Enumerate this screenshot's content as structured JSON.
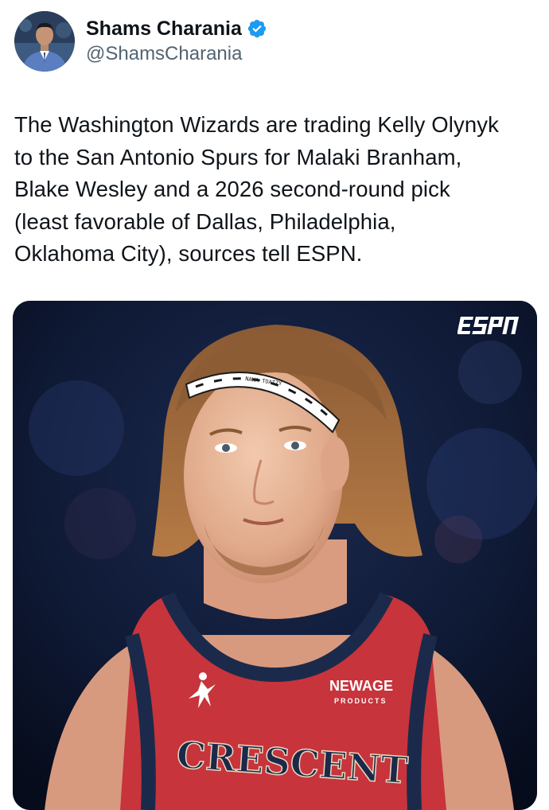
{
  "author": {
    "display_name": "Shams Charania",
    "handle": "@ShamsCharania",
    "verified": true,
    "avatar_icon": "profile-photo-icon",
    "verified_icon": "verified-badge-icon"
  },
  "tweet": {
    "text_lines": [
      "The Washington Wizards are trading Kelly Olynyk",
      "to the San Antonio Spurs for Malaki Branham,",
      "Blake Wesley and a 2026 second-round pick",
      "(least favorable of Dallas, Philadelphia,",
      "Oklahoma City), sources tell ESPN."
    ]
  },
  "media": {
    "logo_text": "ESPN",
    "jersey_text": "CRESCENT",
    "sponsor_text": "NEWAGE",
    "sponsor_subtext": "PRODUCTS",
    "headband_text": "NAWA TOATZY"
  },
  "colors": {
    "text_primary": "#0f1419",
    "text_secondary": "#536471",
    "verified_blue": "#1d9bf0",
    "jersey_red": "#c7343b",
    "jersey_navy": "#1b2a4a",
    "background_dark": "#0b1226"
  }
}
